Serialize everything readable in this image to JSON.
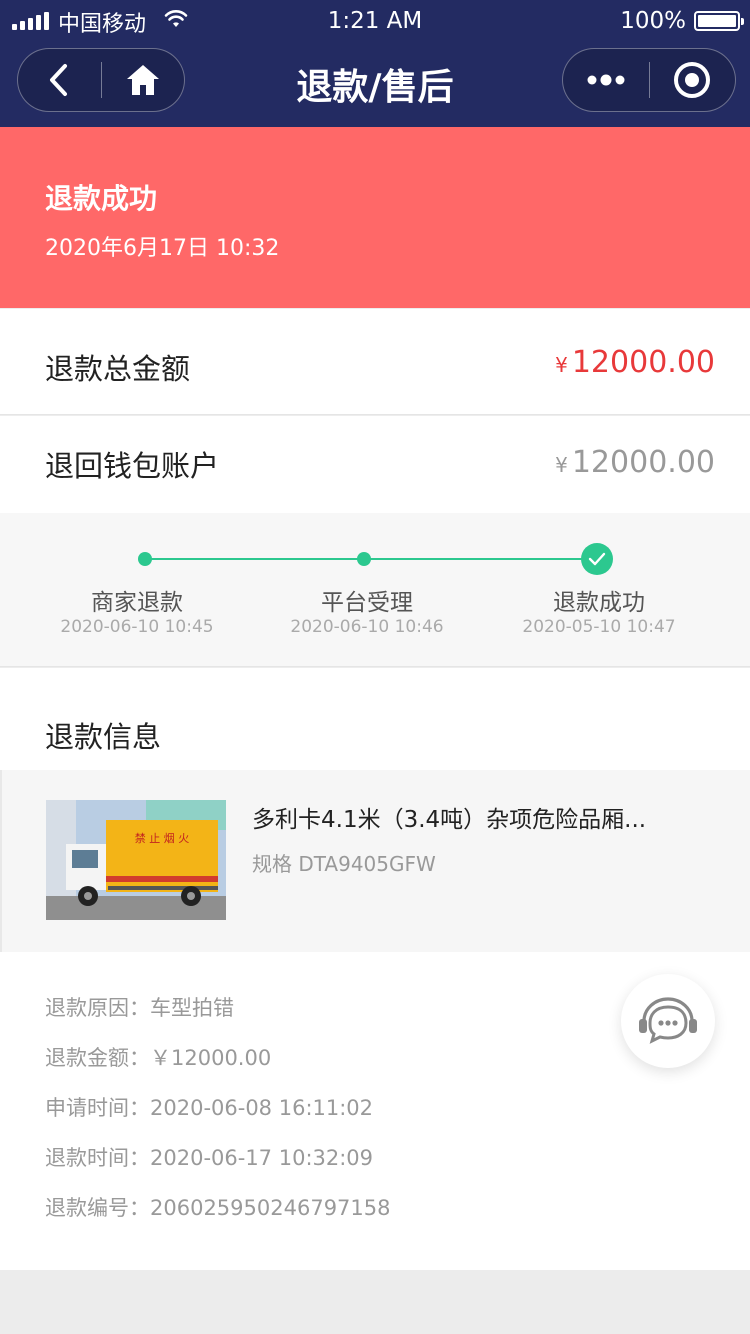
{
  "status_bar": {
    "carrier": "中国移动",
    "time": "1:21 AM",
    "battery": "100%"
  },
  "nav": {
    "title": "退款/售后",
    "back_icon": "chevron-left-icon",
    "home_icon": "home-icon",
    "more_icon": "more-dots-icon",
    "close_icon": "target-circle-icon"
  },
  "banner": {
    "status": "退款成功",
    "date": "2020年6月17日 10:32",
    "color": "#ff6868"
  },
  "amounts": {
    "total_label": "退款总金额",
    "total_currency": "¥",
    "total_value": "12000.00",
    "wallet_label": "退回钱包账户",
    "wallet_currency": "¥",
    "wallet_value": "12000.00"
  },
  "progress": {
    "steps": [
      {
        "label": "商家退款",
        "time": "2020-06-10 10:45"
      },
      {
        "label": "平台受理",
        "time": "2020-06-10 10:46"
      },
      {
        "label": "退款成功",
        "time": "2020-05-10 10:47"
      }
    ]
  },
  "info": {
    "title": "退款信息",
    "product_name": "多利卡4.1米（3.4吨）杂项危险品厢...",
    "product_spec": "规格 DTA9405GFW",
    "truck_sign_text": "禁 止 烟 火"
  },
  "details": [
    {
      "label": "退款原因：",
      "value": "车型拍错"
    },
    {
      "label": "退款金额：",
      "value": "￥12000.00"
    },
    {
      "label": "申请时间：",
      "value": "2020-06-08 16:11:02"
    },
    {
      "label": "退款时间：",
      "value": "2020-06-17 10:32:09"
    },
    {
      "label": "退款编号：",
      "value": "206025950246797158"
    }
  ],
  "service_icon": "customer-service-chat-icon"
}
